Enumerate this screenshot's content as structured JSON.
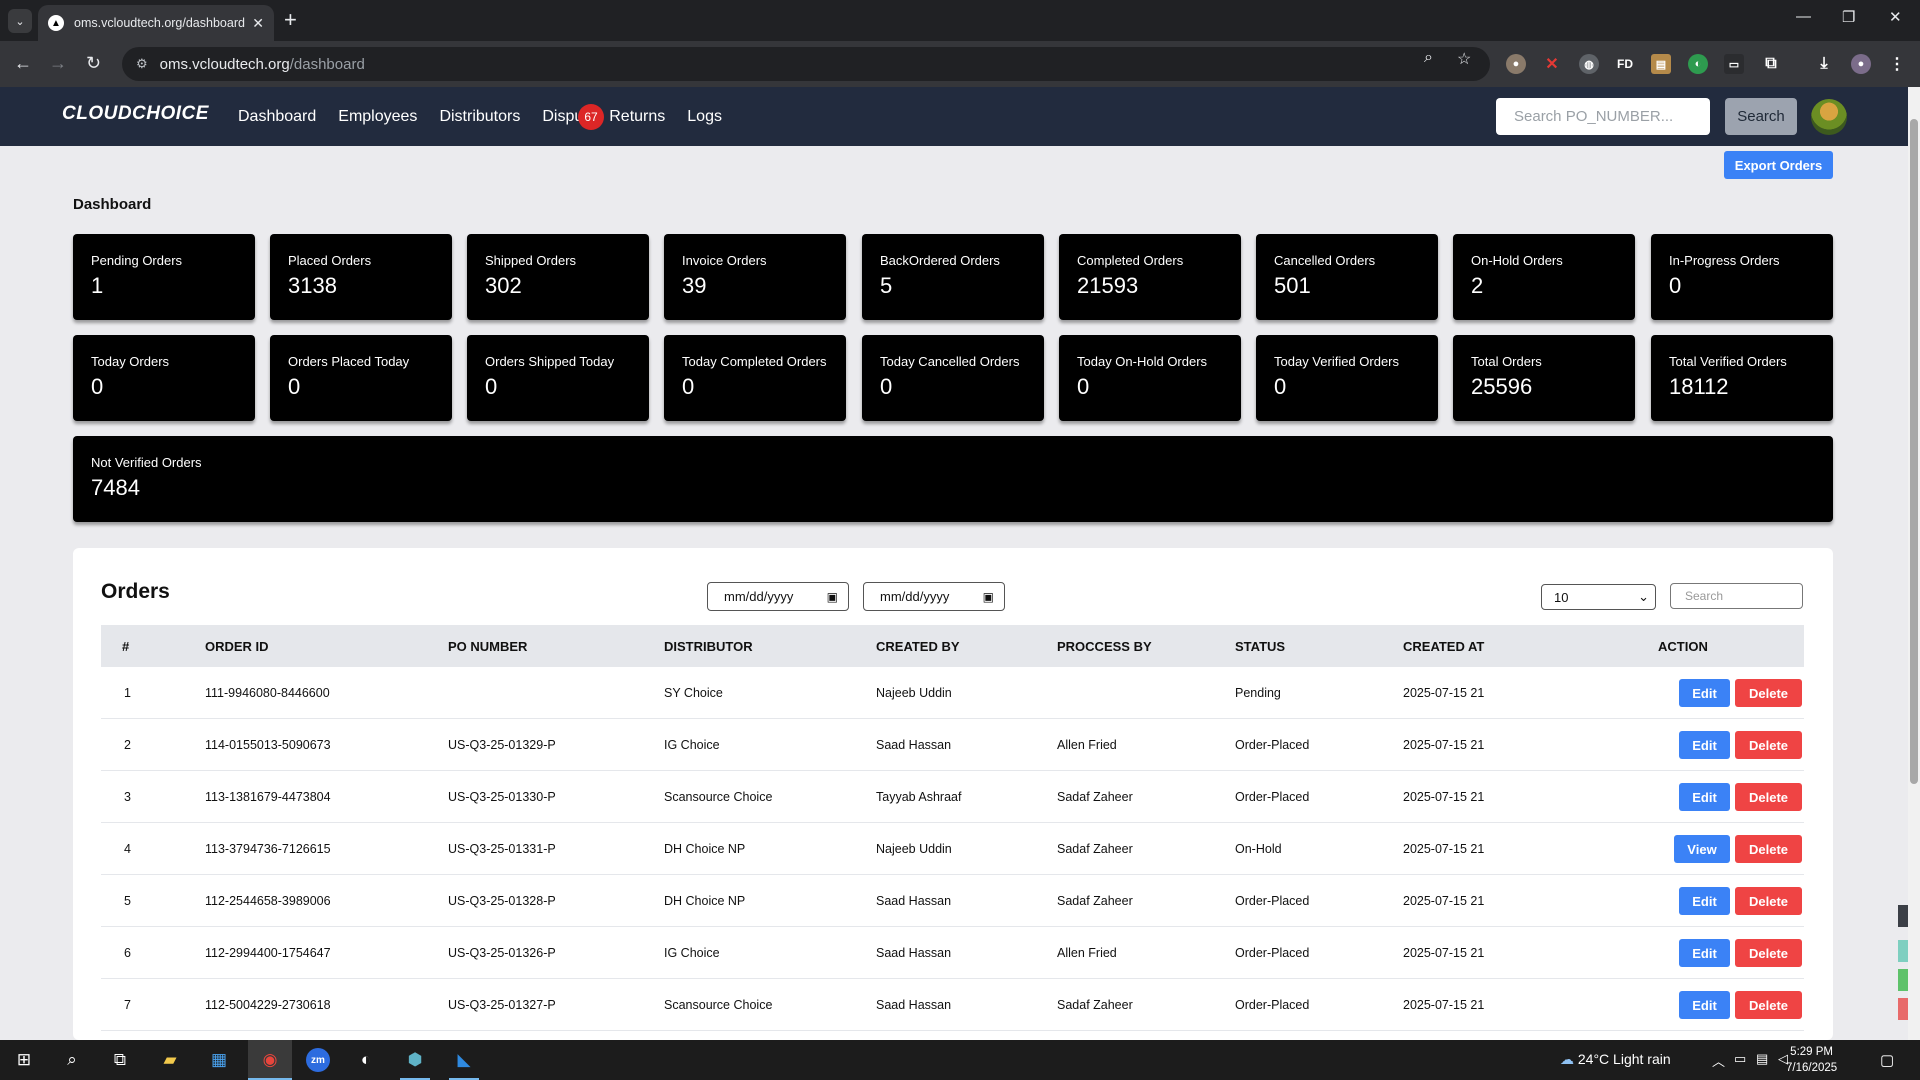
{
  "browser": {
    "tab_title": "oms.vcloudtech.org/dashboard",
    "url_host": "oms.vcloudtech.org",
    "url_path": "/dashboard"
  },
  "navbar": {
    "logo": "CLOUDCHOICE",
    "links": [
      "Dashboard",
      "Employees",
      "Distributors",
      "Dispu",
      "Returns",
      "Logs"
    ],
    "badge_count": "67",
    "search_placeholder": "Search PO_NUMBER...",
    "search_button": "Search"
  },
  "dashboard": {
    "export_button": "Export Orders",
    "title": "Dashboard",
    "cards": [
      {
        "label": "Pending Orders",
        "value": "1"
      },
      {
        "label": "Placed Orders",
        "value": "3138"
      },
      {
        "label": "Shipped Orders",
        "value": "302"
      },
      {
        "label": "Invoice Orders",
        "value": "39"
      },
      {
        "label": "BackOrdered Orders",
        "value": "5"
      },
      {
        "label": "Completed Orders",
        "value": "21593"
      },
      {
        "label": "Cancelled Orders",
        "value": "501"
      },
      {
        "label": "On-Hold Orders",
        "value": "2"
      },
      {
        "label": "In-Progress Orders",
        "value": "0"
      },
      {
        "label": "Today Orders",
        "value": "0"
      },
      {
        "label": "Orders Placed Today",
        "value": "0"
      },
      {
        "label": "Orders Shipped Today",
        "value": "0"
      },
      {
        "label": "Today Completed Orders",
        "value": "0"
      },
      {
        "label": "Today Cancelled Orders",
        "value": "0"
      },
      {
        "label": "Today On-Hold Orders",
        "value": "0"
      },
      {
        "label": "Today Verified Orders",
        "value": "0"
      },
      {
        "label": "Total Orders",
        "value": "25596"
      },
      {
        "label": "Total Verified Orders",
        "value": "18112"
      },
      {
        "label": "Not Verified Orders",
        "value": "7484"
      }
    ]
  },
  "orders": {
    "title": "Orders",
    "date_from_placeholder": "mm/dd/yyyy",
    "date_to_placeholder": "mm/dd/yyyy",
    "page_size": "10",
    "search_placeholder": "Search",
    "columns": [
      "#",
      "ORDER ID",
      "PO NUMBER",
      "DISTRIBUTOR",
      "CREATED BY",
      "PROCCESS BY",
      "STATUS",
      "CREATED AT",
      "ACTION"
    ],
    "rows": [
      {
        "num": "1",
        "order_id": "111-9946080-8446600",
        "po": "",
        "distributor": "SY Choice",
        "created_by": "Najeeb Uddin",
        "process_by": "",
        "status": "Pending",
        "created_at": "2025-07-15 21",
        "action": "Edit",
        "delete": "Delete"
      },
      {
        "num": "2",
        "order_id": "114-0155013-5090673",
        "po": "US-Q3-25-01329-P",
        "distributor": "IG Choice",
        "created_by": "Saad Hassan",
        "process_by": "Allen Fried",
        "status": "Order-Placed",
        "created_at": "2025-07-15 21",
        "action": "Edit",
        "delete": "Delete"
      },
      {
        "num": "3",
        "order_id": "113-1381679-4473804",
        "po": "US-Q3-25-01330-P",
        "distributor": "Scansource Choice",
        "created_by": "Tayyab Ashraaf",
        "process_by": "Sadaf Zaheer",
        "status": "Order-Placed",
        "created_at": "2025-07-15 21",
        "action": "Edit",
        "delete": "Delete"
      },
      {
        "num": "4",
        "order_id": "113-3794736-7126615",
        "po": "US-Q3-25-01331-P",
        "distributor": "DH Choice NP",
        "created_by": "Najeeb Uddin",
        "process_by": "Sadaf Zaheer",
        "status": "On-Hold",
        "created_at": "2025-07-15 21",
        "action": "View",
        "delete": "Delete"
      },
      {
        "num": "5",
        "order_id": "112-2544658-3989006",
        "po": "US-Q3-25-01328-P",
        "distributor": "DH Choice NP",
        "created_by": "Saad Hassan",
        "process_by": "Sadaf Zaheer",
        "status": "Order-Placed",
        "created_at": "2025-07-15 21",
        "action": "Edit",
        "delete": "Delete"
      },
      {
        "num": "6",
        "order_id": "112-2994400-1754647",
        "po": "US-Q3-25-01326-P",
        "distributor": "IG Choice",
        "created_by": "Saad Hassan",
        "process_by": "Allen Fried",
        "status": "Order-Placed",
        "created_at": "2025-07-15 21",
        "action": "Edit",
        "delete": "Delete"
      },
      {
        "num": "7",
        "order_id": "112-5004229-2730618",
        "po": "US-Q3-25-01327-P",
        "distributor": "Scansource Choice",
        "created_by": "Saad Hassan",
        "process_by": "Sadaf Zaheer",
        "status": "Order-Placed",
        "created_at": "2025-07-15 21",
        "action": "Edit",
        "delete": "Delete"
      }
    ]
  },
  "taskbar": {
    "weather": "24°C  Light rain",
    "time": "5:29 PM",
    "date": "7/16/2025"
  },
  "colors": {
    "navbar_bg": "#222b3e",
    "card_bg": "#000000",
    "primary_button": "#3b82f6",
    "danger_button": "#ef4444",
    "badge": "#dc2626"
  }
}
